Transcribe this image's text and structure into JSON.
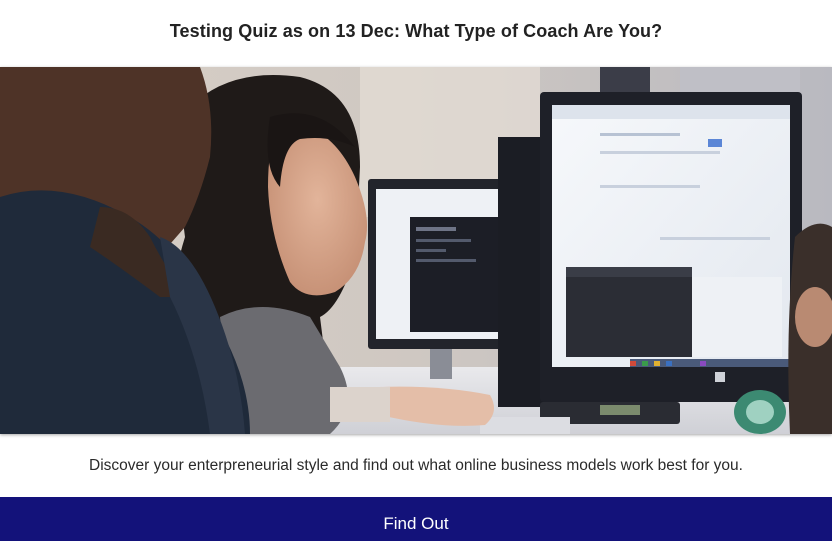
{
  "quiz": {
    "title": "Testing Quiz as on 13 Dec: What Type of Coach Are You?",
    "description": "Discover your enterpreneurial style and find out what online business models work best for you.",
    "cta_label": "Find Out"
  },
  "hero_image": {
    "subject": "photo-women-at-computers"
  },
  "colors": {
    "cta_background": "#13127a",
    "cta_text": "#ffffff",
    "title_text": "#222222"
  }
}
